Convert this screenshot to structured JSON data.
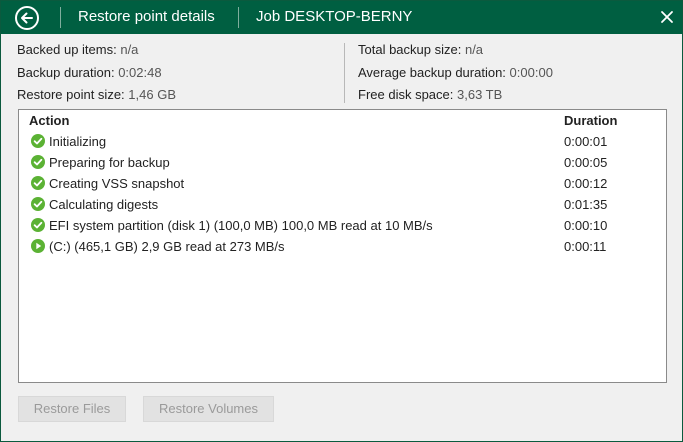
{
  "titlebar": {
    "title": "Restore point details",
    "job": "Job DESKTOP-BERNY"
  },
  "info": {
    "left": [
      {
        "label": "Backed up items:",
        "value": "n/a"
      },
      {
        "label": "Backup duration:",
        "value": "0:02:48"
      },
      {
        "label": "Restore point size:",
        "value": "1,46 GB"
      }
    ],
    "right": [
      {
        "label": "Total backup size:",
        "value": "n/a"
      },
      {
        "label": "Average backup duration:",
        "value": "0:00:00"
      },
      {
        "label": "Free disk space:",
        "value": "3,63 TB"
      }
    ]
  },
  "table": {
    "columns": [
      "Action",
      "Duration"
    ],
    "rows": [
      {
        "status": "success",
        "icon": "check-circle-icon",
        "action": "Initializing",
        "duration": "0:00:01"
      },
      {
        "status": "success",
        "icon": "check-circle-icon",
        "action": "Preparing for backup",
        "duration": "0:00:05"
      },
      {
        "status": "success",
        "icon": "check-circle-icon",
        "action": "Creating VSS snapshot",
        "duration": "0:00:12"
      },
      {
        "status": "success",
        "icon": "check-circle-icon",
        "action": "Calculating digests",
        "duration": "0:01:35"
      },
      {
        "status": "success",
        "icon": "check-circle-icon",
        "action": "EFI system partition (disk 1) (100,0 MB) 100,0 MB read at 10 MB/s",
        "duration": "0:00:10"
      },
      {
        "status": "running",
        "icon": "play-circle-icon",
        "action": "(C:) (465,1 GB) 2,9 GB read at 273 MB/s",
        "duration": "0:00:11"
      }
    ]
  },
  "buttons": {
    "restore_files": "Restore Files",
    "restore_volumes": "Restore Volumes"
  },
  "colors": {
    "titlebar": "#005f41",
    "status_icon": "#5bb234"
  }
}
